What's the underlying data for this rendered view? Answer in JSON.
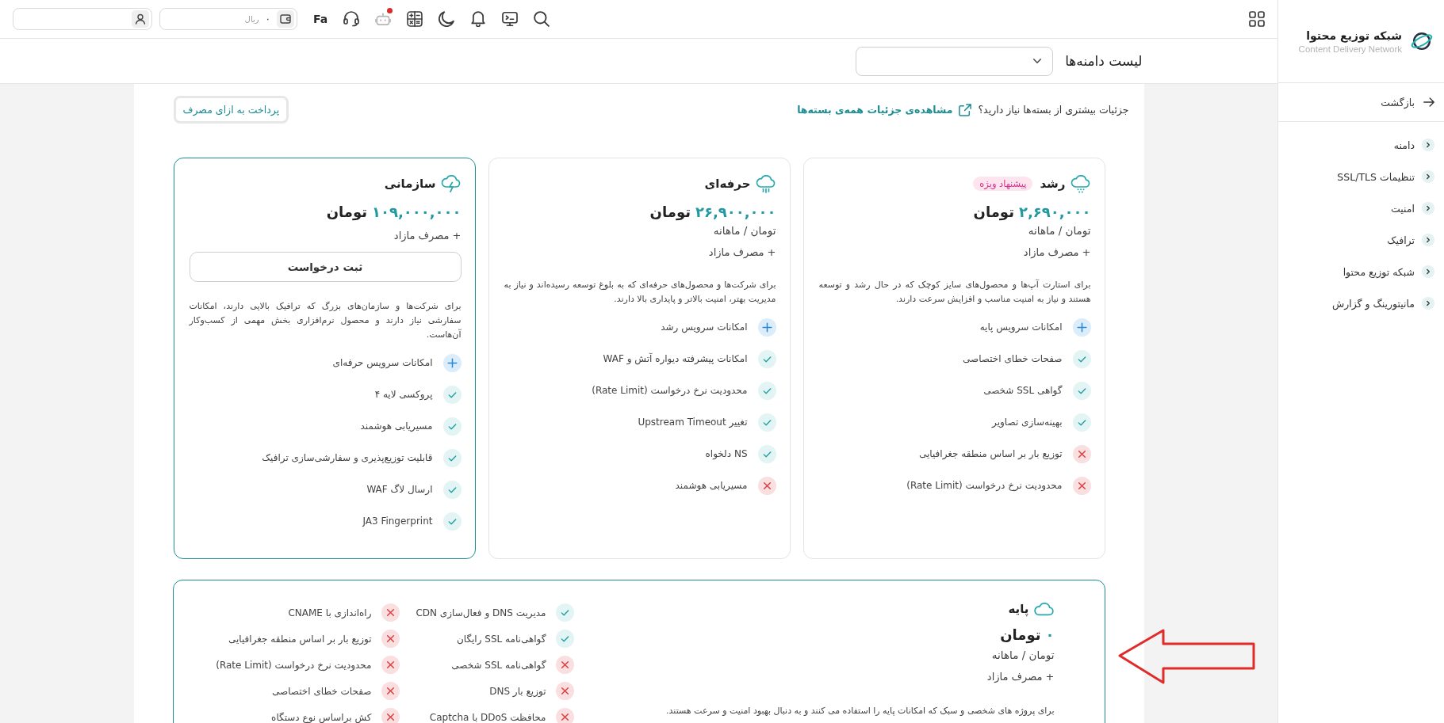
{
  "sidebar": {
    "title": "شبکه توزیع محتوا",
    "subtitle": "Content Delivery Network",
    "back": "بازگشت",
    "items": [
      {
        "label": "دامنه",
        "expanded": false
      },
      {
        "label": "تنظیمات SSL/TLS",
        "expanded": false
      },
      {
        "label": "امنیت",
        "expanded": false
      },
      {
        "label": "ترافیک",
        "expanded": false
      },
      {
        "label": "شبکه توزیع محتوا",
        "expanded": false
      },
      {
        "label": "مانیتورینگ و گزارش",
        "expanded": false
      }
    ]
  },
  "topbar": {
    "language": "Fa",
    "chat_unread": true,
    "wallet": {
      "amount": "۰",
      "currency": "ریال"
    }
  },
  "header": {
    "title": "لیست دامنه‌ها"
  },
  "intro": {
    "question": "جزئیات بیشتری از بسته‌ها نیاز دارید؟",
    "link": "مشاهده‌ی جزئیات همه‌ی بسته‌ها",
    "button": "پرداخت به ازای مصرف"
  },
  "plans": [
    {
      "name": "رشد",
      "badge": "پیشنهاد ویژه",
      "price": "۲,۶۹۰,۰۰۰",
      "currency": "تومان",
      "period": "تومان / ماهانه",
      "extra": "+ مصرف مازاد",
      "description": "برای استارت آپ‌ها و محصول‌های سایز کوچک که در حال رشد و توسعه هستند و نیاز به امنیت مناسب و افزایش سرعت دارند.",
      "highlighted": false,
      "features": [
        {
          "kind": "plus",
          "label": "امکانات سرویس پایه"
        },
        {
          "kind": "check",
          "label": "صفحات خطای اختصاصی"
        },
        {
          "kind": "check",
          "label": "گواهی SSL شخصی"
        },
        {
          "kind": "check",
          "label": "بهینه‌سازی تصاویر"
        },
        {
          "kind": "cross",
          "label": "توزیع بار بر اساس منطقه جغرافیایی"
        },
        {
          "kind": "cross",
          "label": "محدودیت نرخ درخواست (Rate Limit)"
        }
      ]
    },
    {
      "name": "حرفه‌ای",
      "price": "۲۶,۹۰۰,۰۰۰",
      "currency": "تومان",
      "period": "تومان / ماهانه",
      "extra": "+ مصرف مازاد",
      "description": "برای شرکت‌ها و محصول‌های حرفه‌ای که به بلوغ توسعه رسیده‌اند و نیاز به مدیریت بهتر، امنیت بالاتر و پایداری بالا دارند.",
      "highlighted": false,
      "features": [
        {
          "kind": "plus",
          "label": "امکانات سرویس رشد"
        },
        {
          "kind": "check",
          "label": "امکانات پیشرفته دیواره آتش و WAF"
        },
        {
          "kind": "check",
          "label": "محدودیت نرخ درخواست (Rate Limit)"
        },
        {
          "kind": "check",
          "label": "تغییر Upstream Timeout"
        },
        {
          "kind": "check",
          "label": "NS دلخواه"
        },
        {
          "kind": "cross",
          "label": "مسیریابی هوشمند"
        }
      ]
    },
    {
      "name": "سازمانی",
      "price": "۱۰۹,۰۰۰,۰۰۰",
      "currency": "تومان",
      "extra": "+ مصرف مازاد",
      "button": "ثبت درخواست",
      "description": "برای شرکت‌ها و سازمان‌های بزرگ که ترافیک بالایی دارند، امکانات سفارشی نیاز دارند و محصول نرم‌افزاری بخش مهمی از کسب‌وکار آن‌هاست.",
      "highlighted": true,
      "features": [
        {
          "kind": "plus",
          "label": "امکانات سرویس حرفه‌ای"
        },
        {
          "kind": "check",
          "label": "پروکسی لایه ۴"
        },
        {
          "kind": "check",
          "label": "مسیریابی هوشمند"
        },
        {
          "kind": "check",
          "label": "قابلیت توزیع‌پذیری و سفارشی‌سازی ترافیک"
        },
        {
          "kind": "check",
          "label": "ارسال لاگ WAF"
        },
        {
          "kind": "check",
          "label": "JA3 Fingerprint"
        }
      ]
    }
  ],
  "base_plan": {
    "name": "پایه",
    "price": "۰",
    "currency": "تومان",
    "period": "تومان / ماهانه",
    "extra": "+ مصرف مازاد",
    "description": "برای پروژه های شخصی و سبک که امکانات پایه را استفاده می کنند و به دنبال بهبود امنیت و سرعت هستند.",
    "highlighted": true,
    "features": [
      {
        "kind": "check",
        "label": "مدیریت DNS و فعال‌سازی CDN"
      },
      {
        "kind": "check",
        "label": "گواهی‌نامه SSL رایگان"
      },
      {
        "kind": "cross",
        "label": "گواهی‌نامه SSL شخصی"
      },
      {
        "kind": "cross",
        "label": "توزیع بار DNS"
      },
      {
        "kind": "cross",
        "label": "محافظت DDoS با Captcha"
      },
      {
        "kind": "cross",
        "label": "راه‌اندازی با CNAME"
      },
      {
        "kind": "cross",
        "label": "توزیع بار بر اساس منطقه جغرافیایی"
      },
      {
        "kind": "cross",
        "label": "محدودیت نرخ درخواست (Rate Limit)"
      },
      {
        "kind": "cross",
        "label": "صفحات خطای اختصاصی"
      },
      {
        "kind": "cross",
        "label": "کش براساس نوع دستگاه"
      }
    ]
  }
}
